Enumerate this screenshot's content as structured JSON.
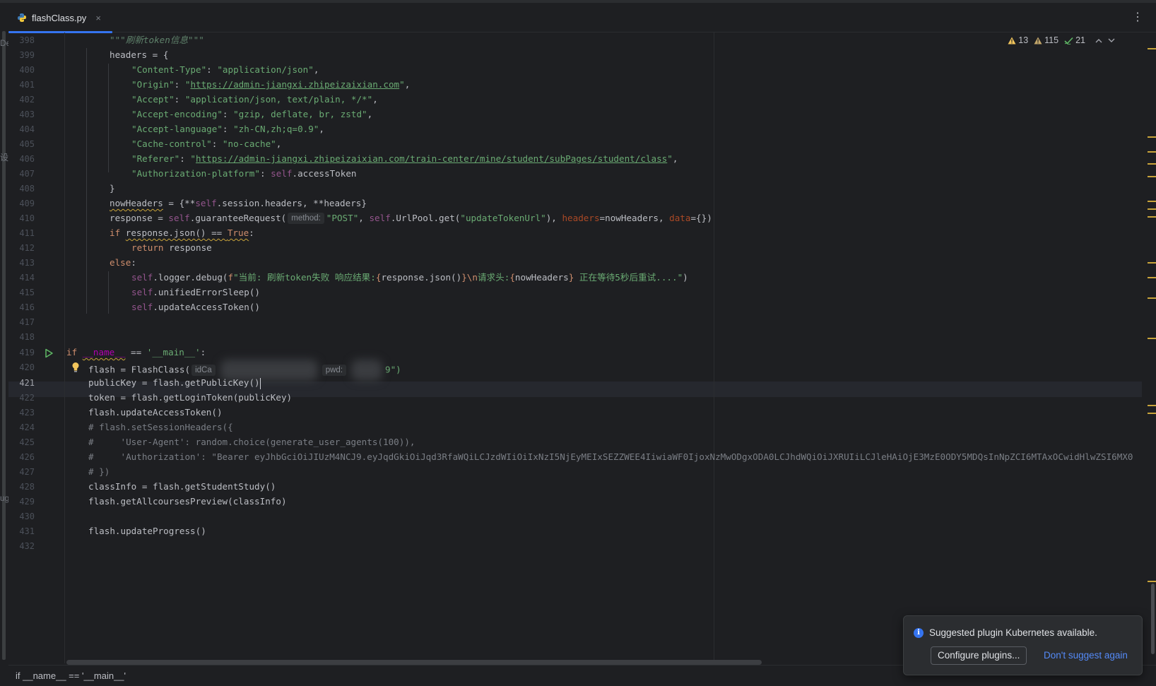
{
  "tab": {
    "icon": "python-file-icon",
    "title": "flashClass.py",
    "close": "×"
  },
  "more_menu": "⋮",
  "inspections": {
    "warnings": "13",
    "weak_warnings": "115",
    "typos": "21"
  },
  "left_panel_fragments": [
    "De",
    "设",
    "ug"
  ],
  "gutter": {
    "lines": [
      "398",
      "399",
      "400",
      "401",
      "402",
      "403",
      "404",
      "405",
      "406",
      "407",
      "408",
      "409",
      "410",
      "411",
      "412",
      "413",
      "414",
      "415",
      "416",
      "417",
      "418",
      "419",
      "420",
      "421",
      "422",
      "423",
      "424",
      "425",
      "426",
      "427",
      "428",
      "429",
      "430",
      "431",
      "432"
    ],
    "current_line": "421"
  },
  "code": {
    "l398": "\"\"\"刷新token信息\"\"\"",
    "l399_a": "headers",
    "l399_b": " = {",
    "l400_k": "\"Content-Type\"",
    "l400_v": "\"application/json\"",
    "l401_k": "\"Origin\"",
    "l401_q1": "\"",
    "l401_url": "https://admin-jiangxi.zhipeizaixian.com",
    "l401_q2": "\"",
    "l402_k": "\"Accept\"",
    "l402_v": "\"application/json, text/plain, */*\"",
    "l403_k": "\"Accept-encoding\"",
    "l403_v": "\"gzip, deflate, br, zstd\"",
    "l404_k": "\"Accept-language\"",
    "l404_v": "\"zh-CN,zh;q=0.9\"",
    "l405_k": "\"Cache-control\"",
    "l405_v": "\"no-cache\"",
    "l406_k": "\"Referer\"",
    "l406_q1": "\"",
    "l406_url": "https://admin-jiangxi.zhipeizaixian.com/train-center/mine/student/subPages/student/class",
    "l406_q2": "\"",
    "l407_k": "\"Authorization-platform\"",
    "l407_self": "self",
    "l407_rest": ".accessToken",
    "l408": "}",
    "l409_var": "nowHeaders",
    "l409_a": " = {**",
    "l409_self": "self",
    "l409_b": ".session.headers, **headers}",
    "l410_a": "response = ",
    "l410_self1": "self",
    "l410_b": ".guaranteeRequest(",
    "l410_hint": "method:",
    "l410_s1": "\"POST\"",
    "l410_c": ", ",
    "l410_self2": "self",
    "l410_d": ".UrlPool.get(",
    "l410_s2": "\"updateTokenUrl\"",
    "l410_e": "), ",
    "l410_kw1": "headers",
    "l410_f": "=nowHeaders, ",
    "l410_kw2": "data",
    "l410_g": "={})",
    "l411_if": "if",
    "l411_mid": "response.json() == ",
    "l411_true": "True",
    "l411_colon": ":",
    "l412_ret": "return",
    "l412_rest": " response",
    "l413_else": "else",
    "l413_colon": ":",
    "l414_self": "self",
    "l414_a": ".logger.debug(",
    "l414_f": "f",
    "l414_s1": "\"当前: 刷新token失败 响应结果:",
    "l414_b1": "{",
    "l414_e1": "response.json()",
    "l414_b2": "}",
    "l414_esc": "\\n",
    "l414_s2": "请求头:",
    "l414_b3": "{",
    "l414_e2": "nowHeaders",
    "l414_b4": "}",
    "l414_s3": " 正在等待5秒后重试....\"",
    "l414_end": ")",
    "l415_self": "self",
    "l415_rest": ".unifiedErrorSleep()",
    "l416_self": "self",
    "l416_rest": ".updateAccessToken()",
    "l419_if": "if",
    "l419_name": "__name__",
    "l419_eq": " == ",
    "l419_main": "'__main__'",
    "l419_colon": ":",
    "l420_a": "flash = FlashClass(",
    "l420_hint1": "idCa",
    "l420_hint2": "pwd:",
    "l420_tail": "9\")",
    "l421_a": "publicKey = flash.getPublicKey(",
    "l421_b": ")",
    "l422": "token = flash.getLoginToken(publicKey)",
    "l423": "flash.updateAccessToken()",
    "l424": "# flash.setSessionHeaders({",
    "l425": "#     'User-Agent': random.choice(generate_user_agents(100)),",
    "l426": "#     'Authorization': \"Bearer eyJhbGciOiJIUzM4NCJ9.eyJqdGkiOiJqd3RfaWQiLCJzdWIiOiIxNzI5NjEyMEIxSEZZWEE4IiwiaWF0IjoxNzMwODgxODA0LCJhdWQiOiJXRUIiLCJleHAiOjE3MzE0ODY5MDQsInNpZCI6MTAxOCwidHlwZSI6MX0",
    "l427": "# })",
    "l428": "classInfo = flash.getStudentStudy()",
    "l429": "flash.getAllcoursesPreview(classInfo)",
    "l431": "flash.updateProgress()"
  },
  "statusbar": {
    "breadcrumb": "if __name__ == '__main__'"
  },
  "notification": {
    "message": "Suggested plugin Kubernetes available.",
    "configure_button": "Configure plugins...",
    "dismiss_link": "Don't suggest again"
  },
  "colors": {
    "background": "#1e1f22",
    "accent": "#3574f0",
    "string": "#6aab73",
    "keyword": "#cf8e6d",
    "self": "#94558d",
    "warning": "#c9a43a"
  }
}
